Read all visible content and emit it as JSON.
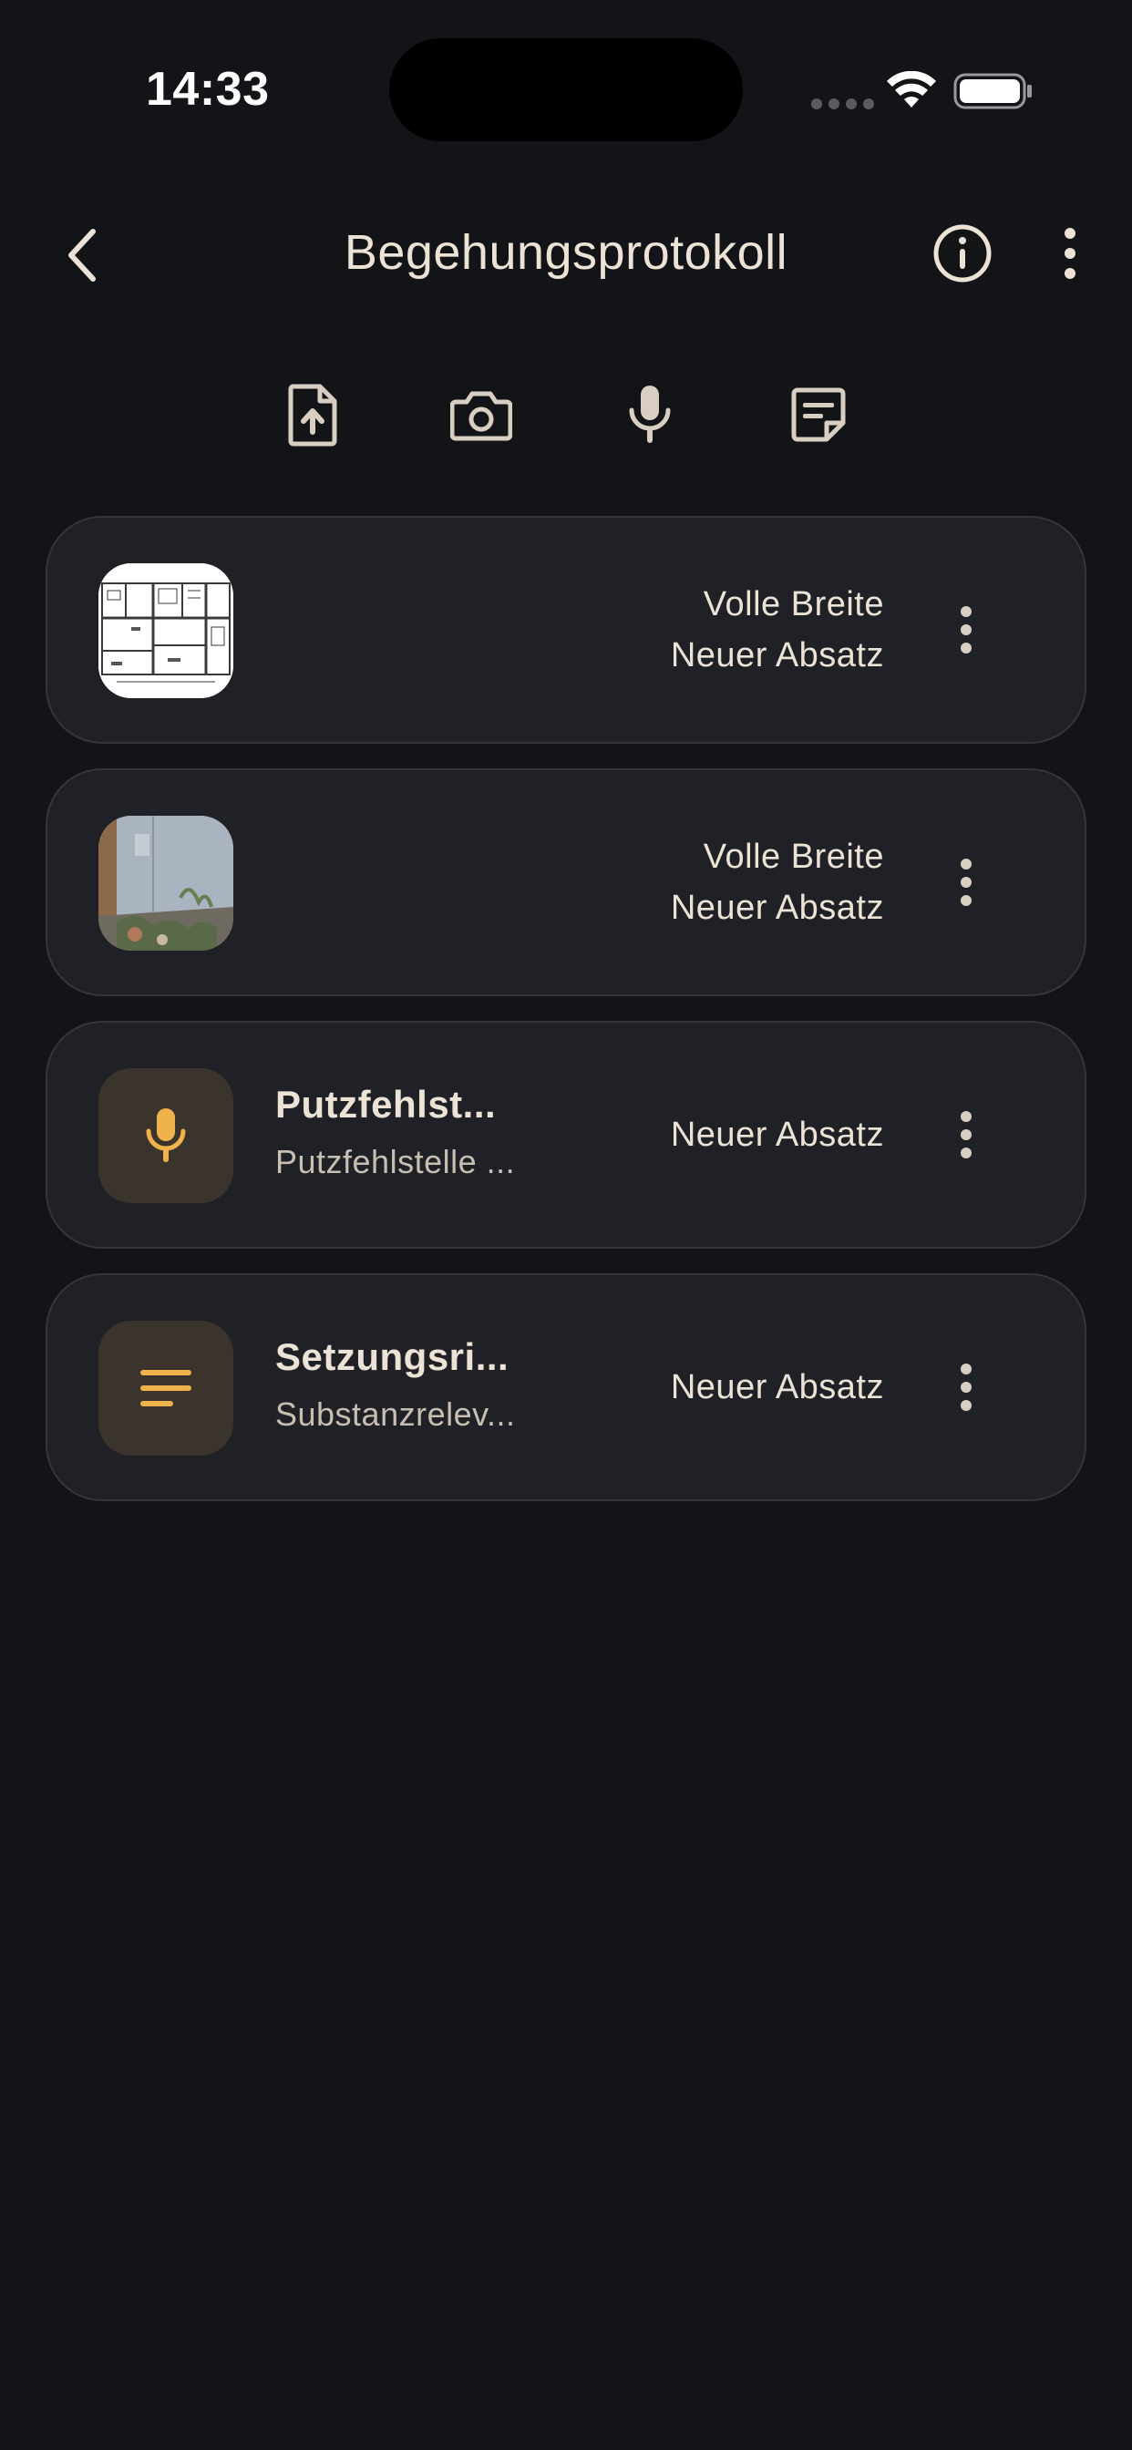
{
  "status_bar": {
    "time": "14:33"
  },
  "nav": {
    "title": "Begehungsprotokoll",
    "back_icon": "chevron-left-icon",
    "info_icon": "info-circle-icon",
    "more_icon": "more-vertical-icon"
  },
  "toolbar": {
    "items": [
      {
        "icon": "file-upload-icon"
      },
      {
        "icon": "camera-icon"
      },
      {
        "icon": "microphone-icon"
      },
      {
        "icon": "note-icon"
      }
    ]
  },
  "items": [
    {
      "kind": "image",
      "thumb": "floor-plan-image",
      "right_line1": "Volle Breite",
      "right_line2": "Neuer Absatz"
    },
    {
      "kind": "image",
      "thumb": "wall-photo-image",
      "right_line1": "Volle Breite",
      "right_line2": "Neuer Absatz"
    },
    {
      "kind": "audio",
      "thumb": "microphone-icon",
      "title": "Putzfehlst...",
      "subtitle": "Putzfehlstelle ...",
      "right_line1": "Neuer Absatz"
    },
    {
      "kind": "text",
      "thumb": "text-lines-icon",
      "title": "Setzungsri...",
      "subtitle": "Substanzrelev...",
      "right_line1": "Neuer Absatz"
    }
  ],
  "colors": {
    "background": "#131418",
    "card": "#1f2126",
    "card_border": "#34363c",
    "accent": "#f0b24a",
    "text": "#ece3d6",
    "icon_tile": "#3a342c"
  }
}
